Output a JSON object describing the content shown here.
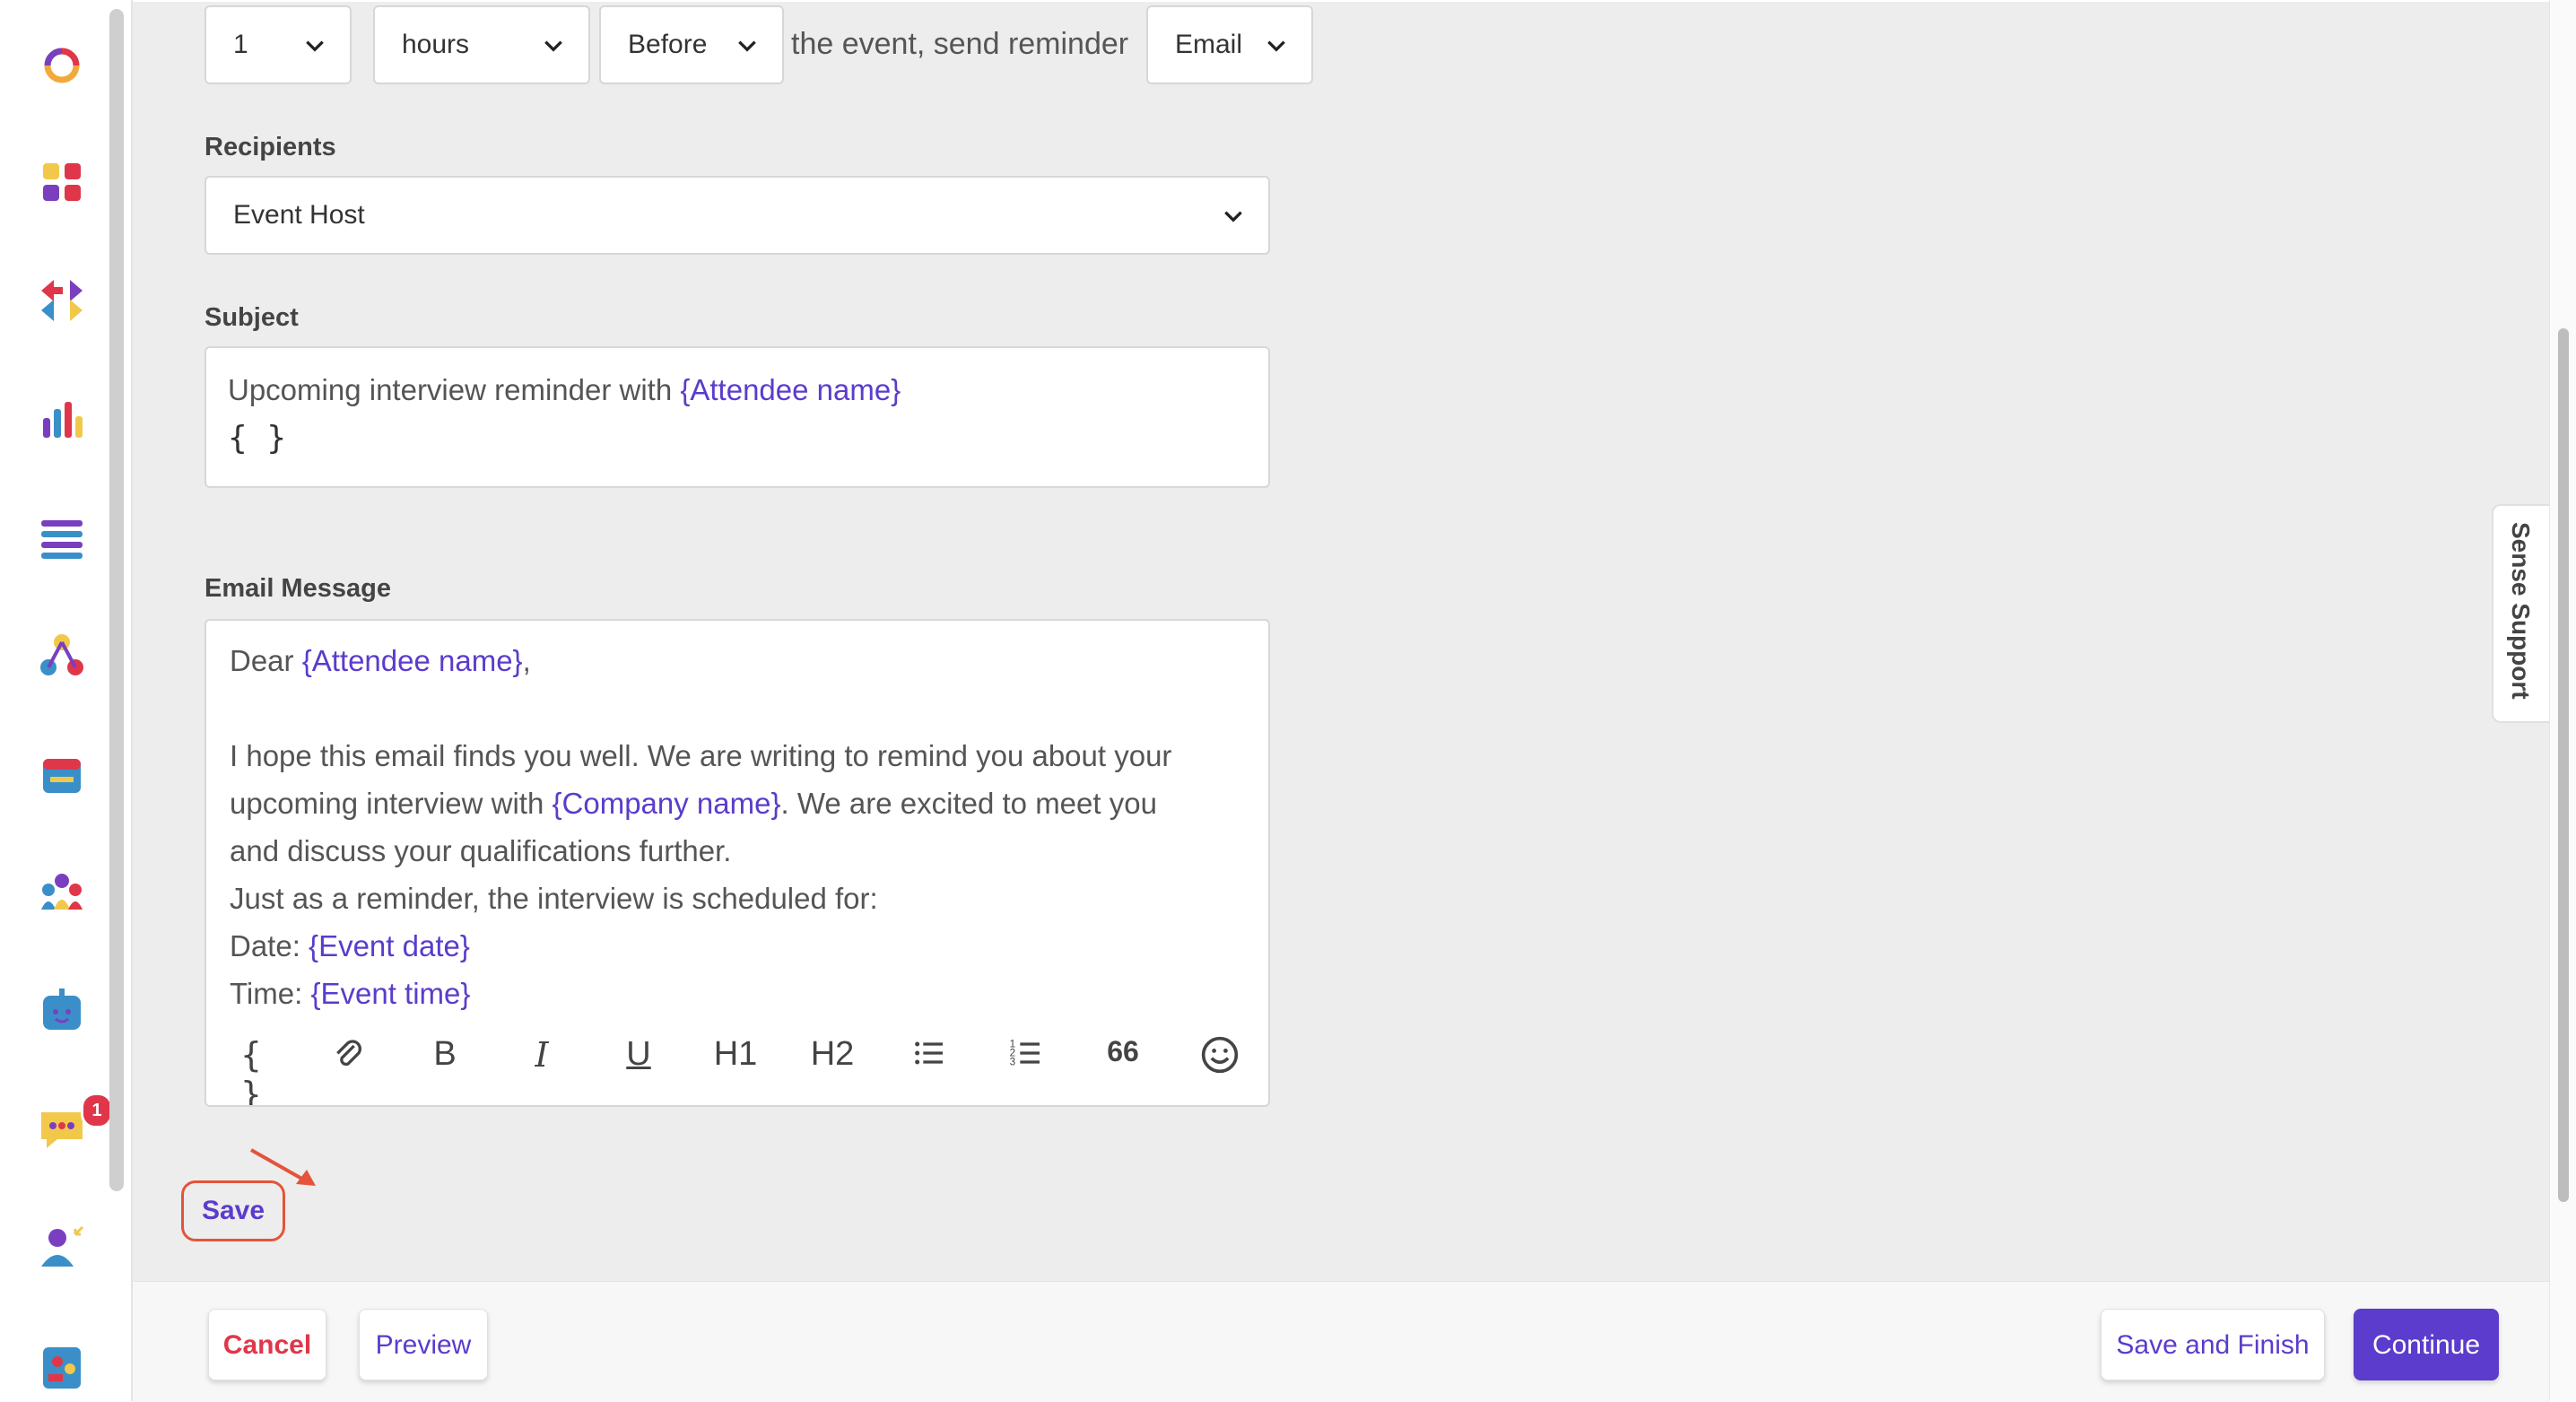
{
  "reminder": {
    "amount": "1",
    "unit": "hours",
    "timing": "Before",
    "connector_text": "the event, send reminder",
    "channel": "Email"
  },
  "recipients": {
    "label": "Recipients",
    "value": "Event Host"
  },
  "subject": {
    "label": "Subject",
    "text_prefix": "Upcoming interview reminder with ",
    "token": "{Attendee name}",
    "placeholder_icon": "{ }"
  },
  "email_message": {
    "label": "Email Message",
    "lines": [
      {
        "before": "Dear ",
        "token": "{Attendee name}",
        "after": ","
      },
      {
        "before": "",
        "token": "",
        "after": ""
      },
      {
        "before": "I hope this email finds you well. We are writing to remind you about your",
        "token": "",
        "after": ""
      },
      {
        "before": "upcoming interview with ",
        "token": "{Company name}",
        "after": ". We are excited to meet you"
      },
      {
        "before": "and discuss your qualifications further.",
        "token": "",
        "after": ""
      },
      {
        "before": "Just as a reminder, the interview is scheduled for:",
        "token": "",
        "after": ""
      },
      {
        "before": "Date: ",
        "token": "{Event date}",
        "after": ""
      },
      {
        "before": "Time: ",
        "token": "{Event time}",
        "after": ""
      }
    ],
    "toolbar": {
      "variables": "{ }",
      "bold": "B",
      "italic": "I",
      "underline": "U",
      "h1": "H1",
      "h2": "H2",
      "quote": "66"
    }
  },
  "save_label": "Save",
  "sense_support": "Sense Support",
  "footer": {
    "cancel": "Cancel",
    "preview": "Preview",
    "save_finish": "Save and Finish",
    "continue": "Continue"
  },
  "notifications_count": "1",
  "colors": {
    "accent": "#5b3ccc",
    "danger": "#e0364a",
    "highlight_outline": "#e5533a",
    "continue_bg": "#5b3ccc"
  }
}
